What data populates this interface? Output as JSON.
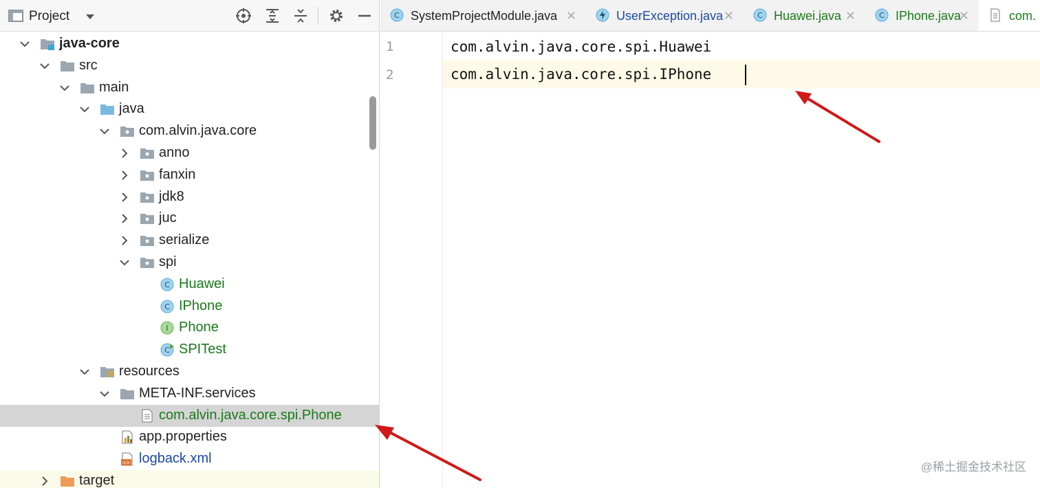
{
  "project": {
    "title": "Project",
    "tree": [
      {
        "label": "java-core",
        "style": "bold",
        "icon": "module-folder-icon",
        "arrow": "down"
      },
      {
        "label": "src",
        "style": "",
        "icon": "folder-icon",
        "arrow": "down"
      },
      {
        "label": "main",
        "style": "",
        "icon": "folder-icon",
        "arrow": "down"
      },
      {
        "label": "java",
        "style": "",
        "icon": "source-folder-icon",
        "arrow": "down"
      },
      {
        "label": "com.alvin.java.core",
        "style": "",
        "icon": "package-icon",
        "arrow": "down"
      },
      {
        "label": "anno",
        "style": "",
        "icon": "package-icon",
        "arrow": "right"
      },
      {
        "label": "fanxin",
        "style": "",
        "icon": "package-icon",
        "arrow": "right"
      },
      {
        "label": "jdk8",
        "style": "",
        "icon": "package-icon",
        "arrow": "right"
      },
      {
        "label": "juc",
        "style": "",
        "icon": "package-icon",
        "arrow": "right"
      },
      {
        "label": "serialize",
        "style": "",
        "icon": "package-icon",
        "arrow": "right"
      },
      {
        "label": "spi",
        "style": "",
        "icon": "package-icon",
        "arrow": "down"
      },
      {
        "label": "Huawei",
        "style": "green",
        "icon": "class-icon",
        "arrow": ""
      },
      {
        "label": "IPhone",
        "style": "green",
        "icon": "class-icon",
        "arrow": ""
      },
      {
        "label": "Phone",
        "style": "green",
        "icon": "interface-icon",
        "arrow": ""
      },
      {
        "label": "SPITest",
        "style": "green",
        "icon": "runnable-class-icon",
        "arrow": ""
      },
      {
        "label": "resources",
        "style": "",
        "icon": "resources-folder-icon",
        "arrow": "down"
      },
      {
        "label": "META-INF.services",
        "style": "",
        "icon": "folder-icon",
        "arrow": "down"
      },
      {
        "label": "com.alvin.java.core.spi.Phone",
        "style": "green",
        "icon": "text-file-icon",
        "arrow": ""
      },
      {
        "label": "app.properties",
        "style": "",
        "icon": "properties-file-icon",
        "arrow": ""
      },
      {
        "label": "logback.xml",
        "style": "blue",
        "icon": "xml-file-icon",
        "arrow": ""
      },
      {
        "label": "target",
        "style": "",
        "icon": "orange-folder-icon",
        "arrow": "right"
      }
    ]
  },
  "tabs": [
    {
      "label": "SystemProjectModule.java",
      "icon": "class-icon",
      "color": "#222222"
    },
    {
      "label": "UserException.java",
      "icon": "exception-icon",
      "color": "#1a4aa6"
    },
    {
      "label": "Huawei.java",
      "icon": "class-icon",
      "color": "#197a19"
    },
    {
      "label": "IPhone.java",
      "icon": "class-icon",
      "color": "#197a19"
    },
    {
      "label": "com.",
      "icon": "text-file-icon",
      "color": "#197a19"
    }
  ],
  "editor": {
    "line_numbers": [
      "1",
      "2"
    ],
    "lines": [
      "com.alvin.java.core.spi.Huawei",
      "com.alvin.java.core.spi.IPhone"
    ]
  },
  "watermark": "@稀土掘金技术社区"
}
